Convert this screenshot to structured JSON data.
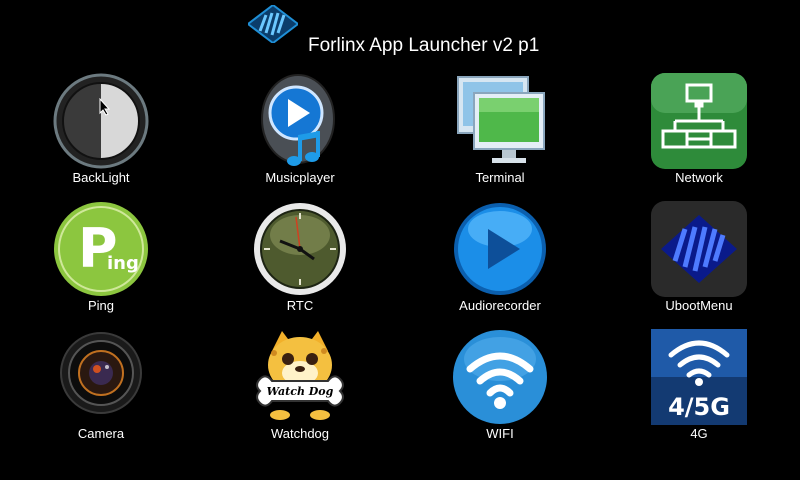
{
  "title": "Forlinx App Launcher v2 p1",
  "apps": [
    {
      "label": "BackLight",
      "icon": "backlight-icon"
    },
    {
      "label": "Musicplayer",
      "icon": "musicplayer-icon"
    },
    {
      "label": "Terminal",
      "icon": "terminal-icon"
    },
    {
      "label": "Network",
      "icon": "network-icon"
    },
    {
      "label": "Ping",
      "icon": "ping-icon",
      "icon_text": "Ping"
    },
    {
      "label": "RTC",
      "icon": "clock-icon"
    },
    {
      "label": "Audiorecorder",
      "icon": "play-icon"
    },
    {
      "label": "UbootMenu",
      "icon": "uboot-logo-icon"
    },
    {
      "label": "Camera",
      "icon": "camera-lens-icon"
    },
    {
      "label": "Watchdog",
      "icon": "watchdog-icon",
      "icon_text": "Watch Dog"
    },
    {
      "label": "WIFI",
      "icon": "wifi-icon"
    },
    {
      "label": "4G",
      "icon": "signal-4g-icon",
      "icon_text": "4/5G"
    }
  ],
  "colors": {
    "background": "#000000",
    "text": "#ffffff",
    "logo_blue": "#1f8fd6",
    "network_green": "#2e8b3a",
    "ping_green": "#8cc63f",
    "wifi_blue": "#2a8fd8",
    "signal_bg": "#1f5aa8"
  }
}
